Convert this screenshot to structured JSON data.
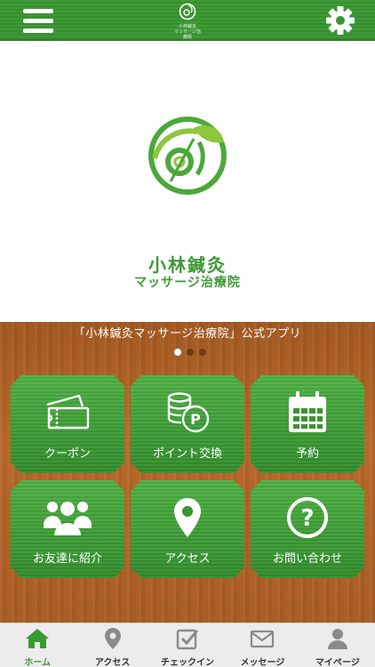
{
  "header": {
    "logo_text_line1": "小林鍼灸",
    "logo_text_line2": "マッサージ治療院",
    "menu_icon": "hamburger-icon",
    "settings_icon": "gear-icon"
  },
  "brand": {
    "name": "小林鍼灸",
    "subtitle": "マッサージ治療院"
  },
  "banner": {
    "text": "「小林鍼灸マッサージ治療院」公式アプリ",
    "page_count": 3,
    "active_page": 1
  },
  "menu": {
    "coupon": "クーポン",
    "points": "ポイント交換",
    "reservation": "予約",
    "invite": "お友達に紹介",
    "access": "アクセス",
    "contact": "お問い合わせ"
  },
  "tabs": {
    "home": "ホーム",
    "access": "アクセス",
    "checkin": "チェックイン",
    "message": "メッセージ",
    "mypage": "マイページ"
  },
  "colors": {
    "brand_green": "#3c9a34",
    "wood": "#b0652a",
    "active_tab": "#3a9a32",
    "inactive_icon": "#8a8a8a"
  }
}
